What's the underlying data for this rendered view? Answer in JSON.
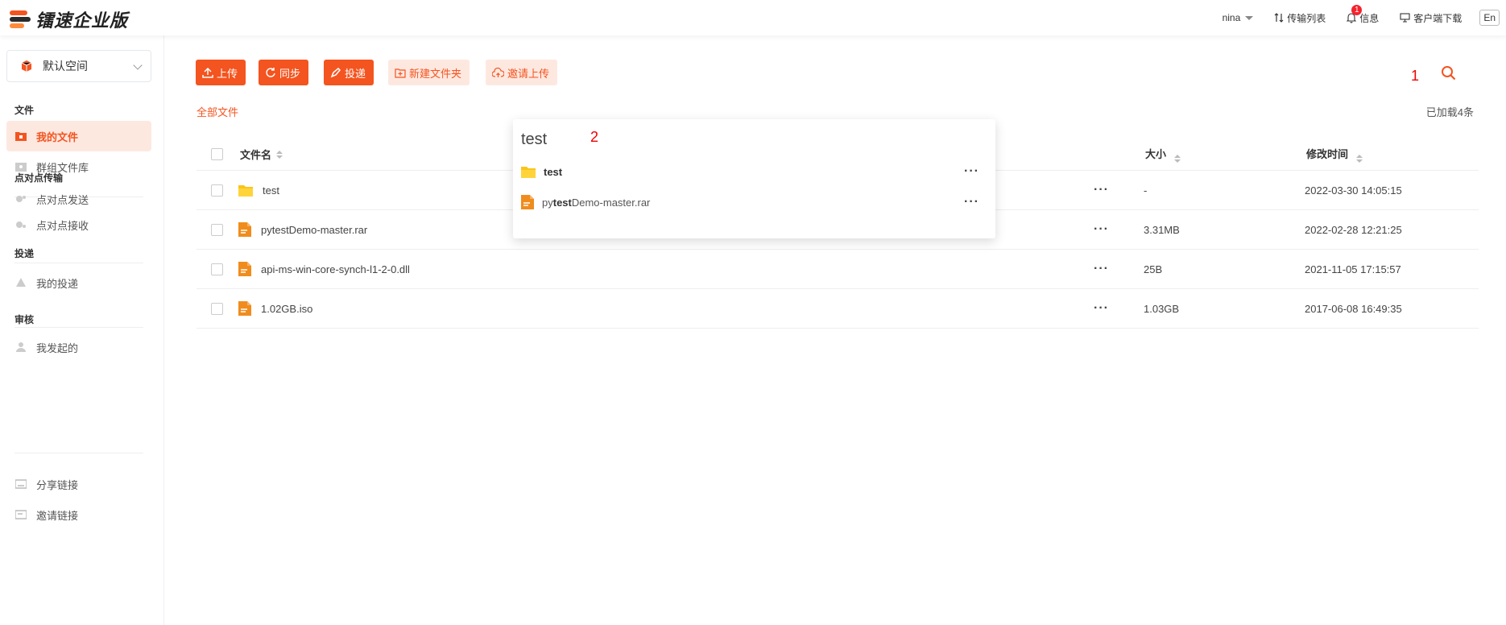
{
  "brand": {
    "name": "镭速企业版",
    "colors": [
      "#f4541f",
      "#ff8a3d",
      "#2b2b2b"
    ]
  },
  "topbar": {
    "user": "nina",
    "transfer_list": "传输列表",
    "messages": "信息",
    "message_badge": "1",
    "client_download": "客户端下载",
    "language": "En"
  },
  "sidebar": {
    "space": "默认空间",
    "sections": {
      "files": "文件",
      "p2p": "点对点传输",
      "delivery": "投递",
      "review": "审核"
    },
    "items": [
      {
        "label": "我的文件",
        "icon": "folder-icon",
        "active": true
      },
      {
        "label": "群组文件库",
        "icon": "group-library-icon"
      },
      {
        "label": "点对点发送",
        "icon": "p2p-send-icon"
      },
      {
        "label": "点对点接收",
        "icon": "p2p-receive-icon"
      },
      {
        "label": "我的投递",
        "icon": "delivery-icon"
      },
      {
        "label": "我发起的",
        "icon": "user-icon"
      },
      {
        "label": "分享链接",
        "icon": "share-link-icon"
      },
      {
        "label": "邀请链接",
        "icon": "invite-link-icon"
      }
    ]
  },
  "toolbar": {
    "upload": "上传",
    "sync": "同步",
    "deliver": "投递",
    "new_folder": "新建文件夹",
    "invite_upload": "邀请上传"
  },
  "breadcrumb": "全部文件",
  "loaded_count": "已加载4条",
  "annotations": {
    "one": "1",
    "two": "2"
  },
  "table": {
    "headers": {
      "name": "文件名",
      "size": "大小",
      "modified": "修改时间"
    },
    "more": "···",
    "rows": [
      {
        "name": "test",
        "type": "folder",
        "size": "-",
        "modified": "2022-03-30 14:05:15"
      },
      {
        "name": "pytestDemo-master.rar",
        "type": "file",
        "size": "3.31MB",
        "modified": "2022-02-28 12:21:25"
      },
      {
        "name": "api-ms-win-core-synch-l1-2-0.dll",
        "type": "file",
        "size": "25B",
        "modified": "2021-11-05 17:15:57"
      },
      {
        "name": "1.02GB.iso",
        "type": "file",
        "size": "1.03GB",
        "modified": "2017-06-08 16:49:35"
      }
    ]
  },
  "search_popup": {
    "query": "test",
    "results": [
      {
        "prefix": "",
        "match": "test",
        "suffix": "",
        "type": "folder"
      },
      {
        "prefix": "py",
        "match": "test",
        "suffix": "Demo-master.rar",
        "type": "file"
      }
    ],
    "more": "···"
  }
}
